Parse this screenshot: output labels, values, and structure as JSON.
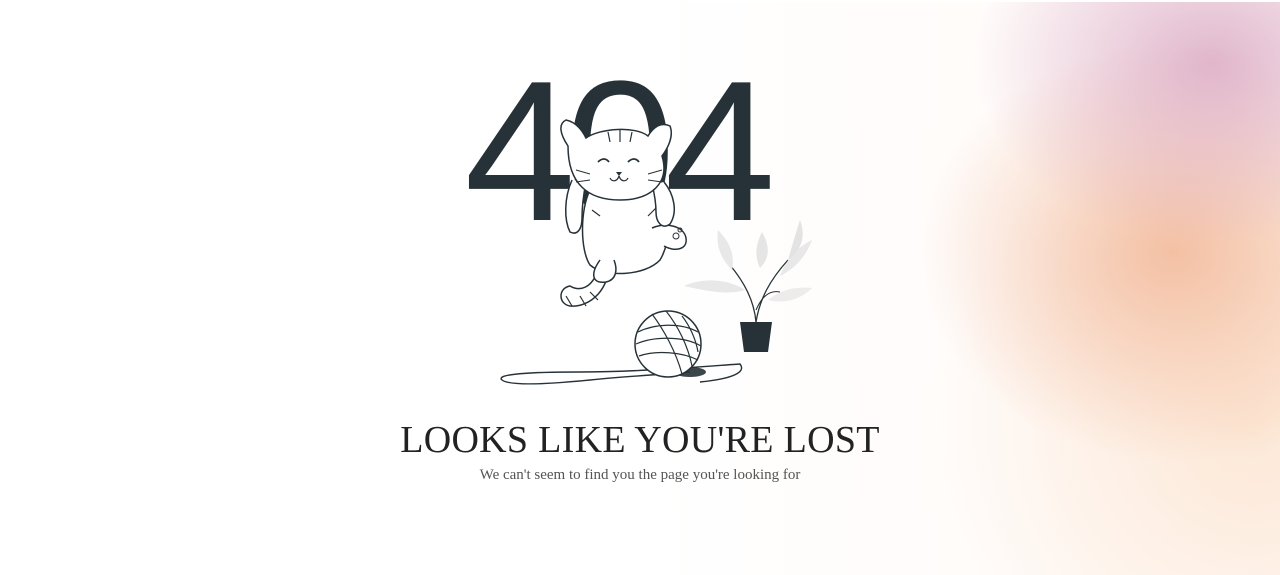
{
  "error": {
    "code_digits": [
      "4",
      "0",
      "4"
    ],
    "heading": "LOOKS LIKE YOU'RE LOST",
    "message": "We can't seem to find you the page you're looking for"
  },
  "illustration": {
    "subject": "cat-jumping-through-404",
    "items": [
      "cat-icon",
      "yarn-ball-icon",
      "potted-plant-icon"
    ]
  },
  "colors": {
    "digits": "#263238",
    "heading": "#222222",
    "message": "#555555",
    "glow_pink": "#d6a0be",
    "glow_peach": "#f0af8c"
  }
}
